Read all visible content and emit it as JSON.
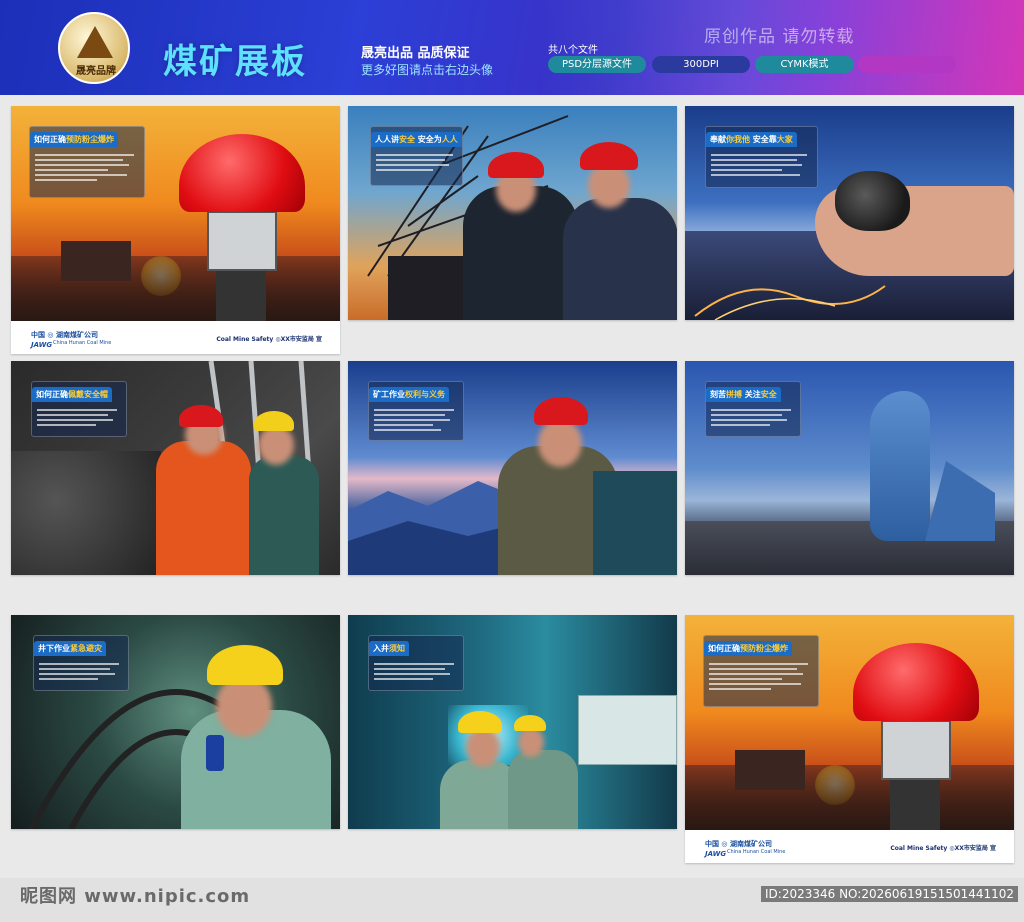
{
  "header": {
    "brand_label": "晟亮品牌",
    "title": "煤矿展板",
    "tagline_1": "晟亮出品  品质保证",
    "tagline_2": "更多好图请点击右边头像",
    "file_count": "共八个文件",
    "pills": [
      "PSD分层源文件",
      "300DPI",
      "CYMK模式",
      ""
    ],
    "watermark": "原创作品  请勿转载"
  },
  "panels": [
    {
      "title_plain": "如何正确",
      "title_highlight": "预防粉尘爆炸",
      "theme": "sunset-helmet",
      "has_footer": true
    },
    {
      "title_plain": "人人讲",
      "title_highlight": "安全",
      "title_plain_2": "  安全为",
      "title_highlight_2": "人人",
      "theme": "crane-workers"
    },
    {
      "title_plain": "奉献",
      "title_highlight": "你我他",
      "title_plain_2": "  安全靠",
      "title_highlight_2": "大家",
      "theme": "coal-hands"
    },
    {
      "title_plain": "如何正确",
      "title_highlight": "佩戴安全帽",
      "theme": "mine-tunnel-workers"
    },
    {
      "title_plain": "矿工作业",
      "title_highlight": "权利与义务",
      "theme": "mountain-worker"
    },
    {
      "title_plain": "刻苦",
      "title_highlight": "拼搏",
      "title_plain_2": "  关注",
      "title_highlight_2": "安全",
      "theme": "miner-statue"
    },
    {
      "title_plain": "井下作业",
      "title_highlight": "紧急避灾",
      "theme": "tunnel-phone"
    },
    {
      "title_plain": "入井",
      "title_highlight": "须知",
      "theme": "tunnel-group"
    },
    {
      "title_plain": "如何正确",
      "title_highlight": "预防粉尘爆炸",
      "theme": "sunset-helmet",
      "has_footer": true
    }
  ],
  "panel_footer": {
    "company": "中国 ◎ 湖南煤矿公司",
    "company_en": "China Hunan Coal Mine",
    "mark": "JAWG",
    "slogan": "Coal Mine Safety ◎XX市安监局  宣"
  },
  "footer": {
    "site": "昵图网 www.nipic.com",
    "id_text": "ID:2023346 NO:20260619151501441102"
  },
  "colors": {
    "banner_start": "#1b2fb8",
    "banner_end": "#c21aa8",
    "title": "#5de1ff",
    "highlight": "#ffcc33"
  }
}
